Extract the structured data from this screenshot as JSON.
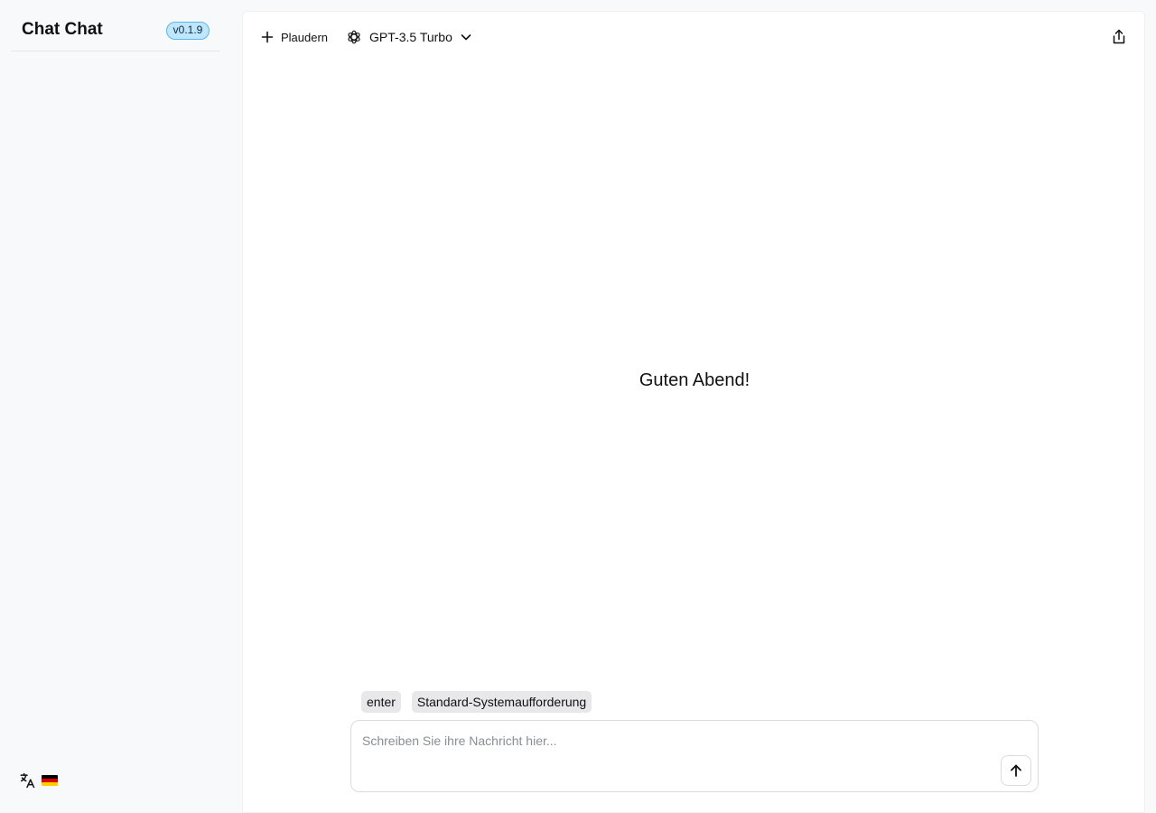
{
  "sidebar": {
    "app_title": "Chat Chat",
    "version": "v0.1.9",
    "footer": {
      "language_icon": "translate-icon",
      "flag": "german-flag",
      "flag_colors": [
        "#000000",
        "#dd0000",
        "#ffce00"
      ]
    }
  },
  "topbar": {
    "new_chat_label": "Plaudern",
    "model_label": "GPT-3.5 Turbo",
    "model_icon": "openai-icon",
    "share_icon": "share-icon"
  },
  "main": {
    "greeting": "Guten Abend!"
  },
  "composer": {
    "chips": [
      {
        "label": "enter"
      },
      {
        "label": "Standard-Systemaufforderung"
      }
    ],
    "placeholder": "Schreiben Sie ihre Nachricht hier...",
    "value": "",
    "send_icon": "arrow-up-icon"
  },
  "colors": {
    "badge_bg": "#bfe6fb",
    "badge_border": "#5ab6ee",
    "sidebar_bg": "#f8f9fb",
    "chip_bg": "#e8e8ea"
  }
}
